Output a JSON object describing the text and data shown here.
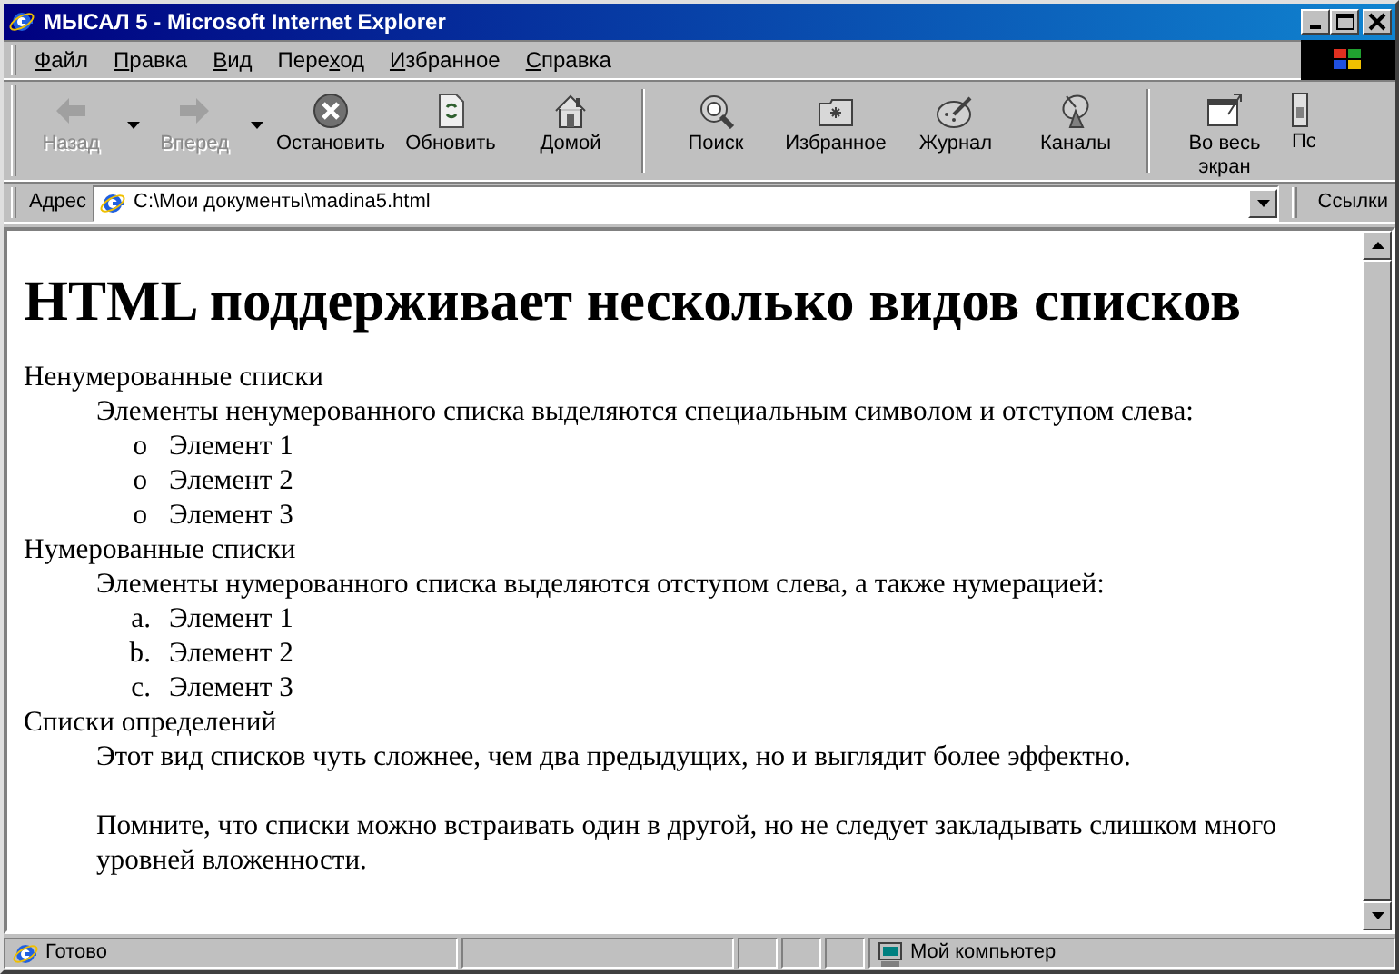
{
  "window": {
    "title": "МЫСАЛ 5 - Microsoft Internet Explorer"
  },
  "menu": [
    {
      "key": "Ф",
      "post": "айл"
    },
    {
      "key": "П",
      "post": "равка"
    },
    {
      "key": "В",
      "post": "ид"
    },
    {
      "pre": "Пере",
      "key": "х",
      "post": "од"
    },
    {
      "key": "И",
      "post": "збранное"
    },
    {
      "key": "С",
      "post": "правка"
    }
  ],
  "toolbar": [
    {
      "kind": "back",
      "label": "Назад",
      "disabled": true
    },
    {
      "kind": "dropdown"
    },
    {
      "kind": "forward",
      "label": "Вперед",
      "disabled": true
    },
    {
      "kind": "dropdown"
    },
    {
      "kind": "stop",
      "label": "Остановить",
      "disabled": false
    },
    {
      "kind": "refresh",
      "label": "Обновить",
      "disabled": false
    },
    {
      "kind": "home",
      "label": "Домой",
      "disabled": false
    },
    {
      "kind": "separator"
    },
    {
      "kind": "search",
      "label": "Поиск",
      "disabled": false
    },
    {
      "kind": "favorites",
      "label": "Избранное",
      "disabled": false
    },
    {
      "kind": "history",
      "label": "Журнал",
      "disabled": false
    },
    {
      "kind": "channels",
      "label": "Каналы",
      "disabled": false
    },
    {
      "kind": "separator"
    },
    {
      "kind": "fullscreen",
      "label": "Во весь экран",
      "disabled": false
    },
    {
      "kind": "cut",
      "label": "Пс",
      "disabled": false
    }
  ],
  "address_bar": {
    "label": "Адрес",
    "value": "C:\\Мои документы\\madina5.html",
    "links": "Ссылки"
  },
  "document": {
    "heading": "HTML поддерживает несколько видов списков",
    "sections": [
      {
        "term": "Ненумерованные списки",
        "description": [
          "Элементы ненумерованного списка выделяются специальным символом и отступом слева:"
        ],
        "list": {
          "kind": "unordered",
          "items": [
            {
              "marker": "o",
              "text": "Элемент 1"
            },
            {
              "marker": "o",
              "text": "Элемент 2"
            },
            {
              "marker": "o",
              "text": "Элемент 3"
            }
          ]
        }
      },
      {
        "term": "Нумерованные списки",
        "description": [
          "Элементы нумерованного списка выделяются отступом слева, а также нумерацией:"
        ],
        "list": {
          "kind": "ordered",
          "items": [
            {
              "marker": "a.",
              "text": "Элемент 1"
            },
            {
              "marker": "b.",
              "text": "Элемент 2"
            },
            {
              "marker": "c.",
              "text": "Элемент 3"
            }
          ]
        }
      },
      {
        "term": "Списки определений",
        "description": [
          "Этот вид списков чуть сложнее, чем два предыдущих, но и выглядит более эффектно.",
          "Помните, что списки можно встраивать один в другой, но не следует закладывать слишком много уровней вложенности."
        ]
      }
    ]
  },
  "status_bar": {
    "text": "Готово",
    "zone": "Мой компьютер"
  }
}
